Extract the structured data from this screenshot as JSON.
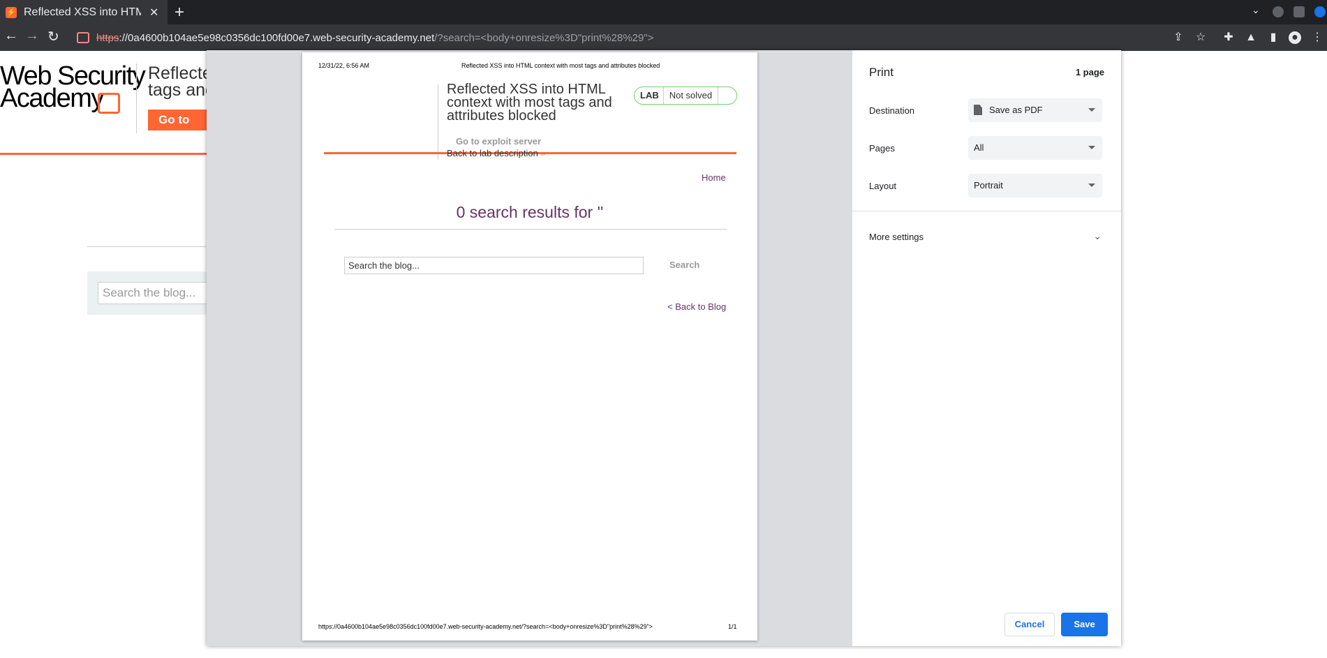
{
  "browser": {
    "tab_title": "Reflected XSS into HTML c",
    "tab_favicon": "⚡",
    "url_scheme": "https",
    "url_host": "://0a4600b104ae5e98c0356dc100fd00e7.web-security-academy.net",
    "url_path": "/?search=<body+onresize%3D\"print%28%29\">",
    "icons": [
      "back-arrow-icon",
      "forward-arrow-icon",
      "reload-icon",
      "share-icon",
      "star-icon",
      "extensions-icon",
      "labs-icon",
      "sidepanel-icon",
      "profile-icon",
      "menu-icon"
    ]
  },
  "site": {
    "logo_line1": "Web Security",
    "logo_line2": "Academy",
    "title_line1": "Reflecte",
    "title_line2": "tags anc",
    "button_label": "Go to exp",
    "search_placeholder": "Search the blog..."
  },
  "print_preview": {
    "date": "12/31/22, 6:56 AM",
    "header_title": "Reflected XSS into HTML context with most tags and attributes blocked",
    "lab_title": "Reflected XSS into HTML context with most tags and attributes blocked",
    "badge_lab": "LAB",
    "badge_status": "Not solved",
    "exploit_link": "Go to exploit server",
    "back_lab": "Back to lab description",
    "back_lab_arrow": "»",
    "home_link": "Home",
    "results_text": "0 search results for ''",
    "search_placeholder": "Search the blog...",
    "search_button": "Search",
    "back_blog": "< Back to Blog",
    "footer_url": "https://0a4600b104ae5e98c0356dc100fd00e7.web-security-academy.net/?search=<body+onresize%3D\"print%28%29\">",
    "footer_page": "1/1"
  },
  "settings": {
    "title": "Print",
    "page_count": "1 page",
    "destination_label": "Destination",
    "destination_value": "Save as PDF",
    "pages_label": "Pages",
    "pages_value": "All",
    "layout_label": "Layout",
    "layout_value": "Portrait",
    "more_settings": "More settings",
    "cancel": "Cancel",
    "save": "Save"
  },
  "colors": {
    "accent_orange": "#ff6633",
    "link_purple": "#663366",
    "google_blue": "#1a73e8",
    "badge_green": "#70d16d"
  }
}
